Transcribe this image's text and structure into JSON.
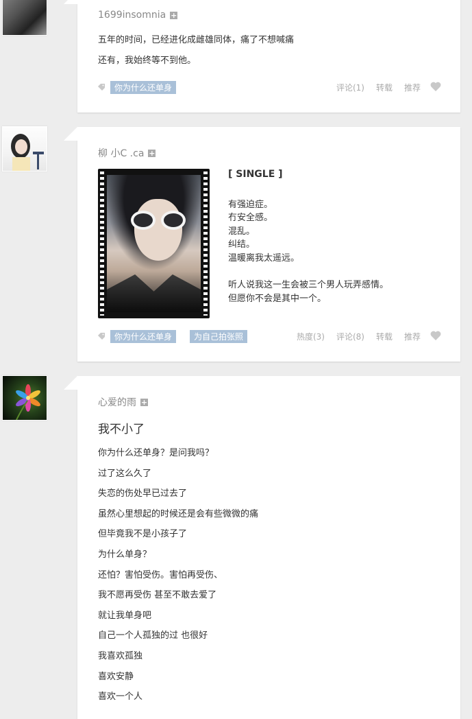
{
  "post1": {
    "author": "1699insomnia",
    "lines": [
      "五年的时间，已经进化成雌雄同体，痛了不想喊痛",
      "还有，我始终等不到他。"
    ],
    "tags": [
      "你为什么还单身"
    ],
    "actions": {
      "comment": "评论(1)",
      "reblog": "转载",
      "recommend": "推荐"
    }
  },
  "post2": {
    "author": "柳 小C .ca",
    "text_title": "[ SINGLE ]",
    "text_lines": [
      "有强迫症。",
      "冇安全感。",
      "混乱。",
      "纠结。",
      "温暖离我太遥远。"
    ],
    "text_lines2": [
      "听人说我这一生会被三个男人玩弄感情。",
      "但愿你不会是其中一个。"
    ],
    "tags": [
      "你为什么还单身",
      "为自己拍张照"
    ],
    "actions": {
      "heat": "热度(3)",
      "comment": "评论(8)",
      "reblog": "转载",
      "recommend": "推荐"
    }
  },
  "post3": {
    "author": "心爱的雨",
    "title": "我不小了",
    "lines": [
      "你为什么还单身？是问我吗？",
      "过了这么久了",
      "失恋的伤处早已过去了",
      "虽然心里想起的时候还是会有些微微的痛",
      "但毕竟我不是小孩子了",
      "为什么单身？",
      "还怕？害怕受伤。害怕再受伤、",
      "我不愿再受伤 甚至不敢去爱了",
      "就让我单身吧",
      "自己一个人孤独的过 也很好",
      "我喜欢孤独",
      "喜欢安静",
      "喜欢一个人"
    ]
  },
  "icons": {
    "follow": "plus-icon",
    "tag": "tag-icon",
    "like": "heart-icon"
  },
  "colors": {
    "tag_bg": "#a9c0d8",
    "page_bg": "#ededed"
  }
}
